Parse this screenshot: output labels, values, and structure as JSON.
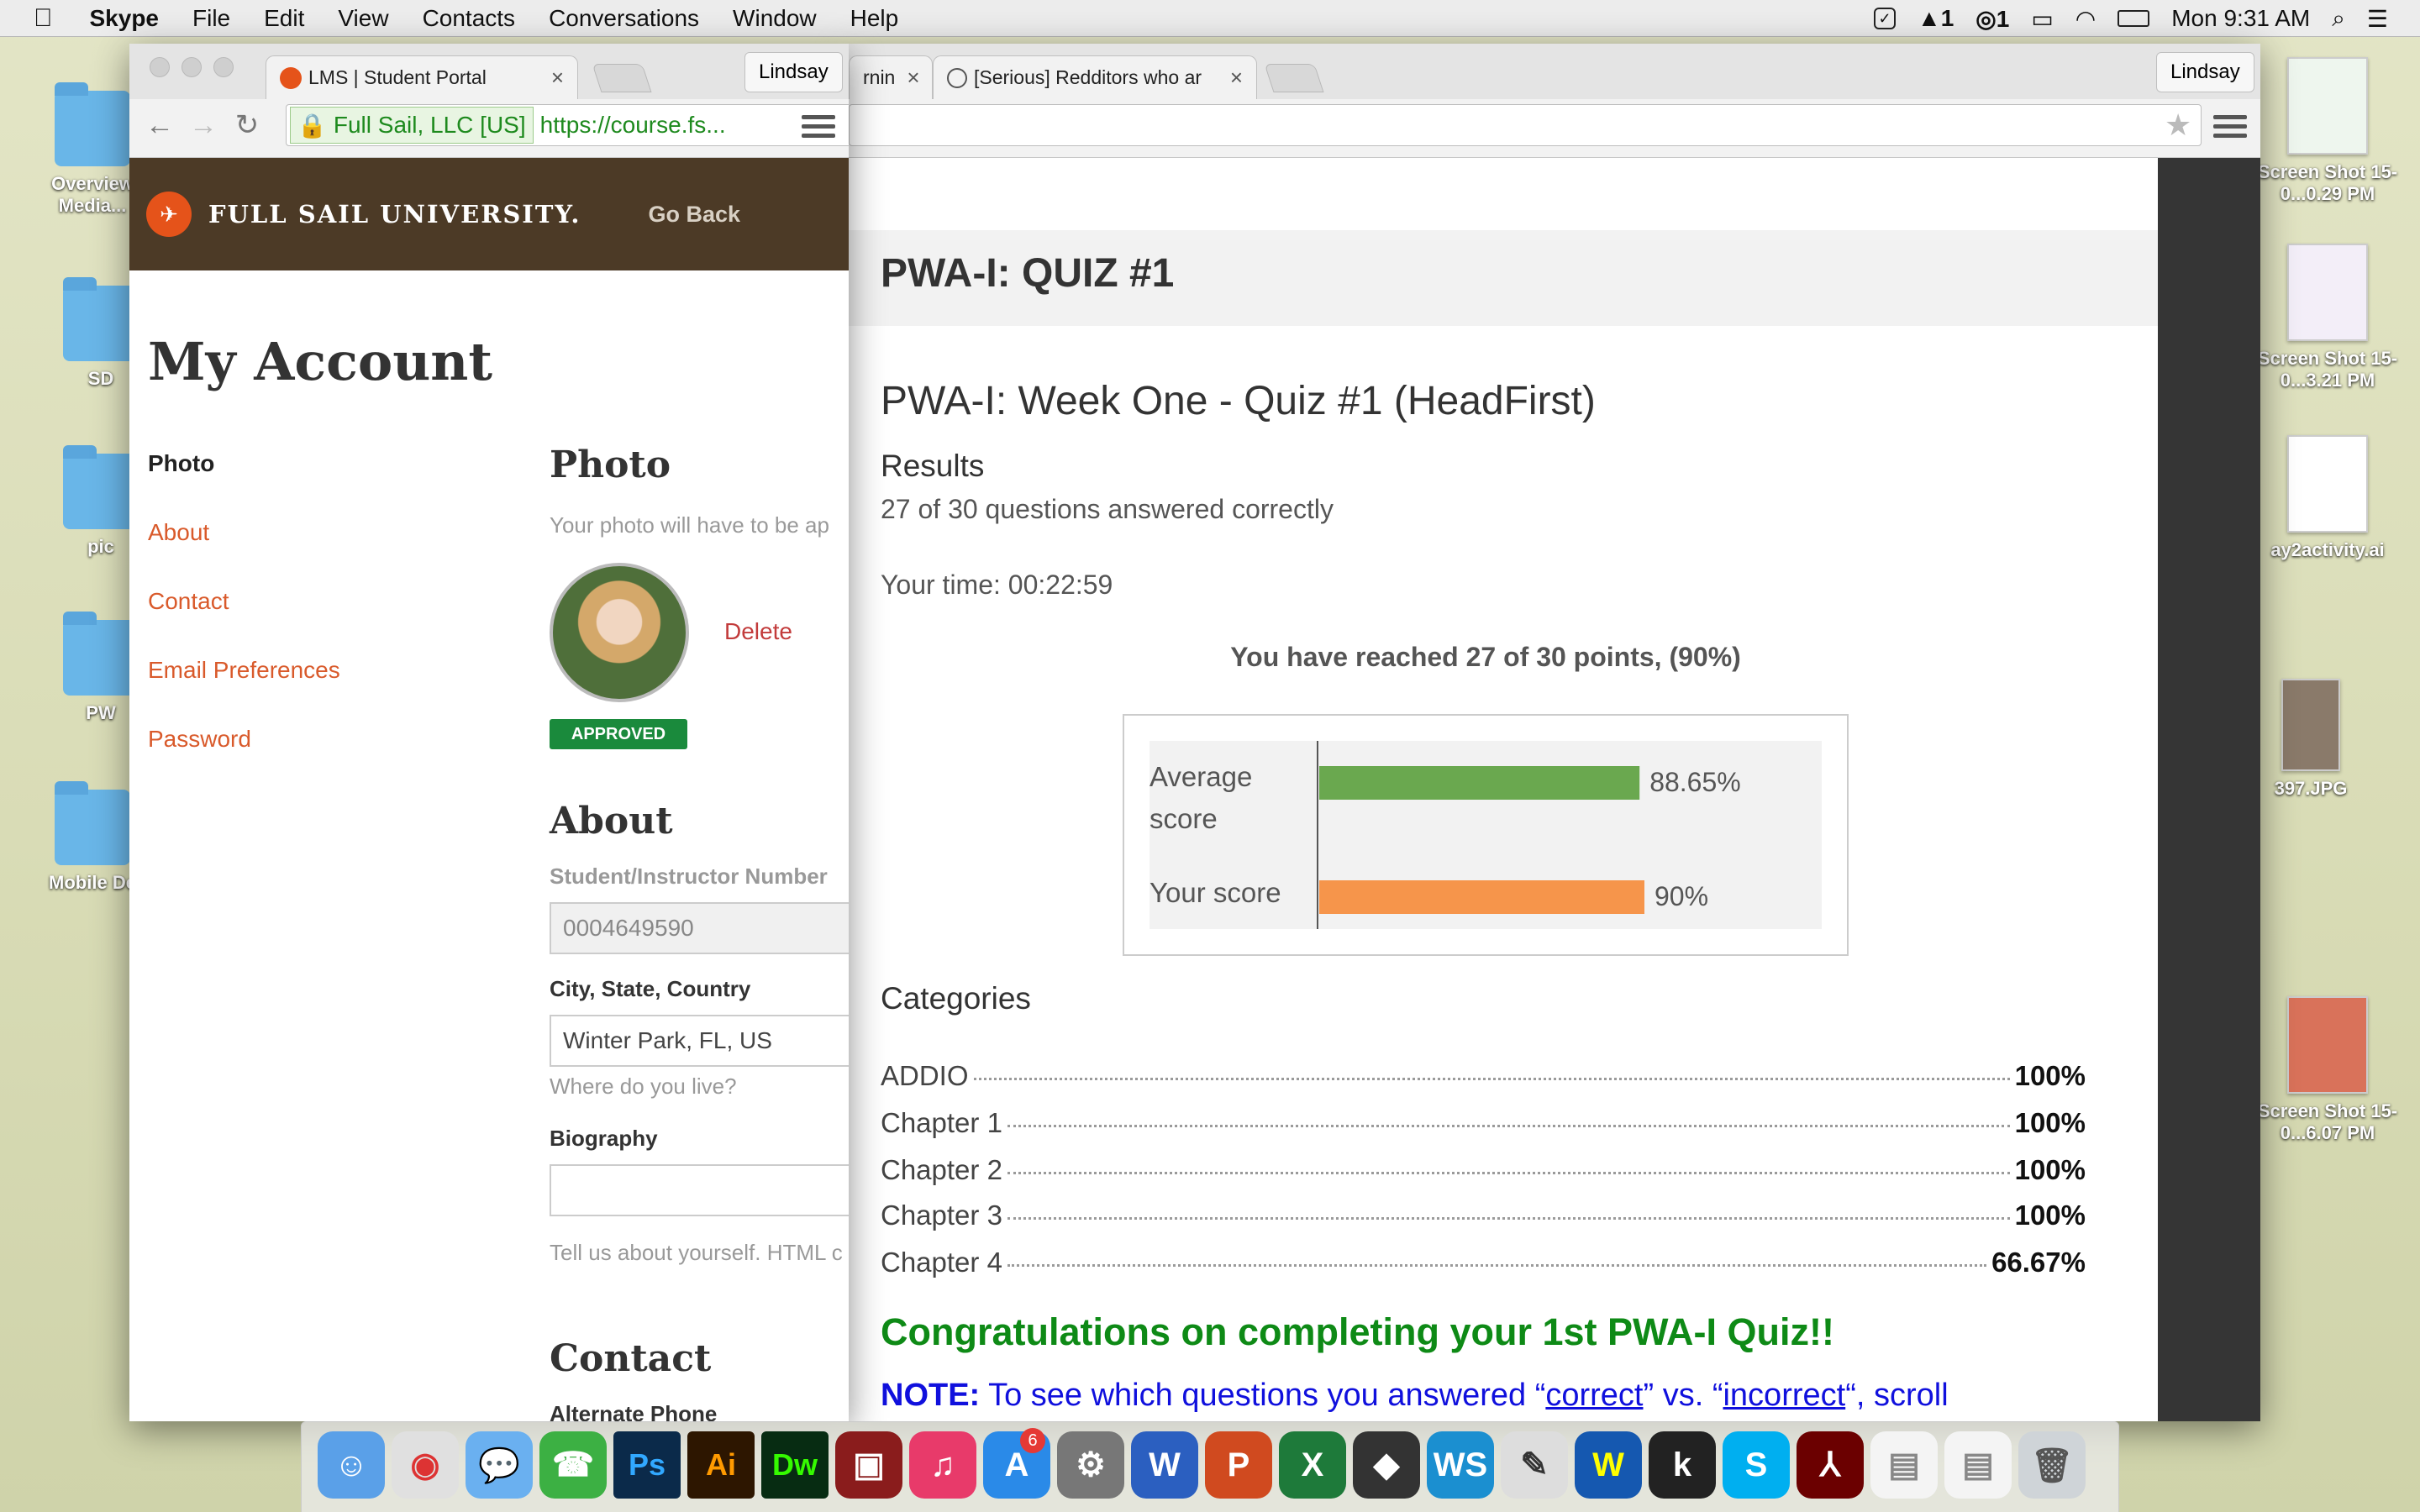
{
  "menubar": {
    "apple": "",
    "app_name": "Skype",
    "items": [
      "File",
      "Edit",
      "View",
      "Contacts",
      "Conversations",
      "Window",
      "Help"
    ],
    "status_adobe": "1",
    "status_cc": "1",
    "clock": "Mon 9:31 AM"
  },
  "desktop": {
    "left_icons": [
      "Overview Media...",
      "SD",
      "pic",
      "PW",
      "Mobile De"
    ],
    "right_icons": [
      "Screen Shot 15-0...0.29 PM",
      "Screen Shot 15-0...3.21 PM",
      "ay2activity.ai",
      "397.JPG",
      "Screen Shot 15-0...6.07 PM"
    ]
  },
  "back_window": {
    "tab1_title": "rnin",
    "tab2_title": "[Serious] Redditors who ar",
    "profile": "Lindsay"
  },
  "front_window": {
    "tab_title": "LMS | Student Portal",
    "profile": "Lindsay",
    "ev_label": "Full Sail, LLC [US]",
    "url": "https://course.fs..."
  },
  "fsu": {
    "brand": "FULL SAIL UNIVERSITY.",
    "go_back": "Go Back",
    "page_title": "My Account",
    "nav": [
      "Photo",
      "About",
      "Contact",
      "Email Preferences",
      "Password"
    ],
    "photo": {
      "heading": "Photo",
      "help": "Your photo will have to be ap",
      "delete": "Delete",
      "status": "APPROVED"
    },
    "about": {
      "heading": "About",
      "id_label": "Student/Instructor Number",
      "id_value": "0004649590",
      "city_label": "City, State, Country",
      "city_value": "Winter Park, FL, US",
      "city_help": "Where do you live?",
      "bio_label": "Biography",
      "bio_help": "Tell us about yourself. HTML c"
    },
    "contact": {
      "heading": "Contact",
      "phone_label": "Alternate Phone",
      "phone_placeholder": "(###)###-####"
    }
  },
  "quiz": {
    "banner_title": "PWA-I: QUIZ #1",
    "quiz_title": "PWA-I: Week One - Quiz #1 (HeadFirst)",
    "results_label": "Results",
    "answered": "27 of 30 questions answered correctly",
    "time": "Your time: 00:22:59",
    "points": "You have reached 27 of 30 points, (90%)",
    "categories_label": "Categories",
    "categories": [
      {
        "name": "ADDIO",
        "pct": "100%"
      },
      {
        "name": "Chapter 1",
        "pct": "100%"
      },
      {
        "name": "Chapter 2",
        "pct": "100%"
      },
      {
        "name": "Chapter 3",
        "pct": "100%"
      },
      {
        "name": "Chapter 4",
        "pct": "66.67%"
      }
    ],
    "congrats": "Congratulations on completing your 1st PWA-I Quiz!!",
    "note_label": "NOTE:",
    "note_pre": " To see which questions you answered “",
    "note_correct": "correct",
    "note_mid": "” vs. “",
    "note_incorrect": "incorrect",
    "note_post": "“, scroll"
  },
  "chart_data": {
    "type": "bar",
    "orientation": "horizontal",
    "categories": [
      "Average score",
      "Your score"
    ],
    "values": [
      88.65,
      90
    ],
    "value_labels": [
      "88.65%",
      "90%"
    ],
    "xlim": [
      0,
      100
    ],
    "colors": [
      "#6aa84f",
      "#f6954b"
    ],
    "grid": false
  },
  "colors": {
    "fsu_brown": "#4c3a26",
    "fsu_orange": "#d95a2b",
    "approved_green": "#1a8a3c",
    "congrats_green": "#0e8a16",
    "note_blue": "#1010dd"
  },
  "dock": [
    "Finder",
    "Chrome",
    "Messages",
    "FaceTime",
    "Ps",
    "Ai",
    "Dw",
    "Photo Booth",
    "iTunes",
    "App Store",
    "System Preferences",
    "W",
    "P",
    "X",
    "GitHub",
    "WS",
    "Brush",
    "Winamp",
    "kindle",
    "S",
    "Acrobat",
    "Documents",
    "Downloads",
    "Trash"
  ],
  "dock_badge_appstore": "6"
}
